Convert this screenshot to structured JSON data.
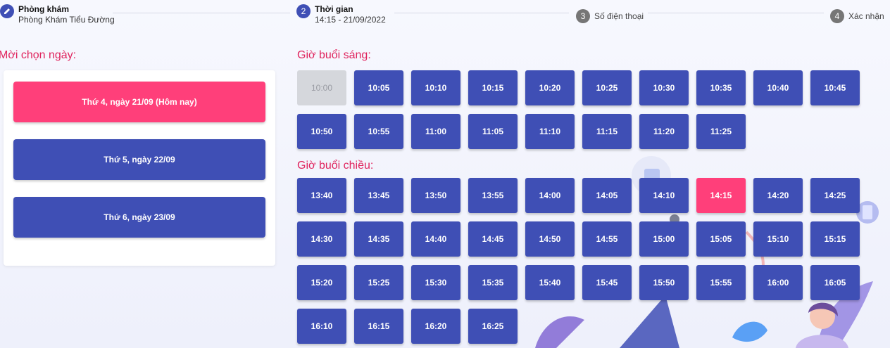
{
  "stepper": {
    "steps": [
      {
        "num": "",
        "title": "Phòng khám",
        "sub": "Phòng Khám Tiểu Đường",
        "icon": "pencil-icon"
      },
      {
        "num": "2",
        "title": "Thời gian",
        "sub": "14:15 - 21/09/2022"
      },
      {
        "num": "3",
        "label": "Số điện thoại"
      },
      {
        "num": "4",
        "label": "Xác nhận"
      }
    ]
  },
  "day_section": {
    "title": "Mời chọn ngày:",
    "days": [
      {
        "label": "Thứ 4, ngày 21/09 (Hôm nay)",
        "state": "selected"
      },
      {
        "label": "Thứ 5, ngày 22/09",
        "state": "normal"
      },
      {
        "label": "Thứ 6, ngày 23/09",
        "state": "normal"
      }
    ]
  },
  "morning": {
    "title": "Giờ buổi sáng:",
    "slots": [
      "10:00",
      "10:05",
      "10:10",
      "10:15",
      "10:20",
      "10:25",
      "10:30",
      "10:35",
      "10:40",
      "10:45",
      "10:50",
      "10:55",
      "11:00",
      "11:05",
      "11:10",
      "11:15",
      "11:20",
      "11:25"
    ],
    "disabled": [
      "10:00"
    ]
  },
  "afternoon": {
    "title": "Giờ buổi chiều:",
    "slots": [
      "13:40",
      "13:45",
      "13:50",
      "13:55",
      "14:00",
      "14:05",
      "14:10",
      "14:15",
      "14:20",
      "14:25",
      "14:30",
      "14:35",
      "14:40",
      "14:45",
      "14:50",
      "14:55",
      "15:00",
      "15:05",
      "15:10",
      "15:15",
      "15:20",
      "15:25",
      "15:30",
      "15:35",
      "15:40",
      "15:45",
      "15:50",
      "15:55",
      "16:00",
      "16:05",
      "16:10",
      "16:15",
      "16:20",
      "16:25"
    ],
    "selected": "14:15"
  },
  "colors": {
    "primary": "#3f4fb5",
    "accent": "#ff3f7a",
    "heading": "#e0245e",
    "disabled": "#d5d7dc"
  }
}
